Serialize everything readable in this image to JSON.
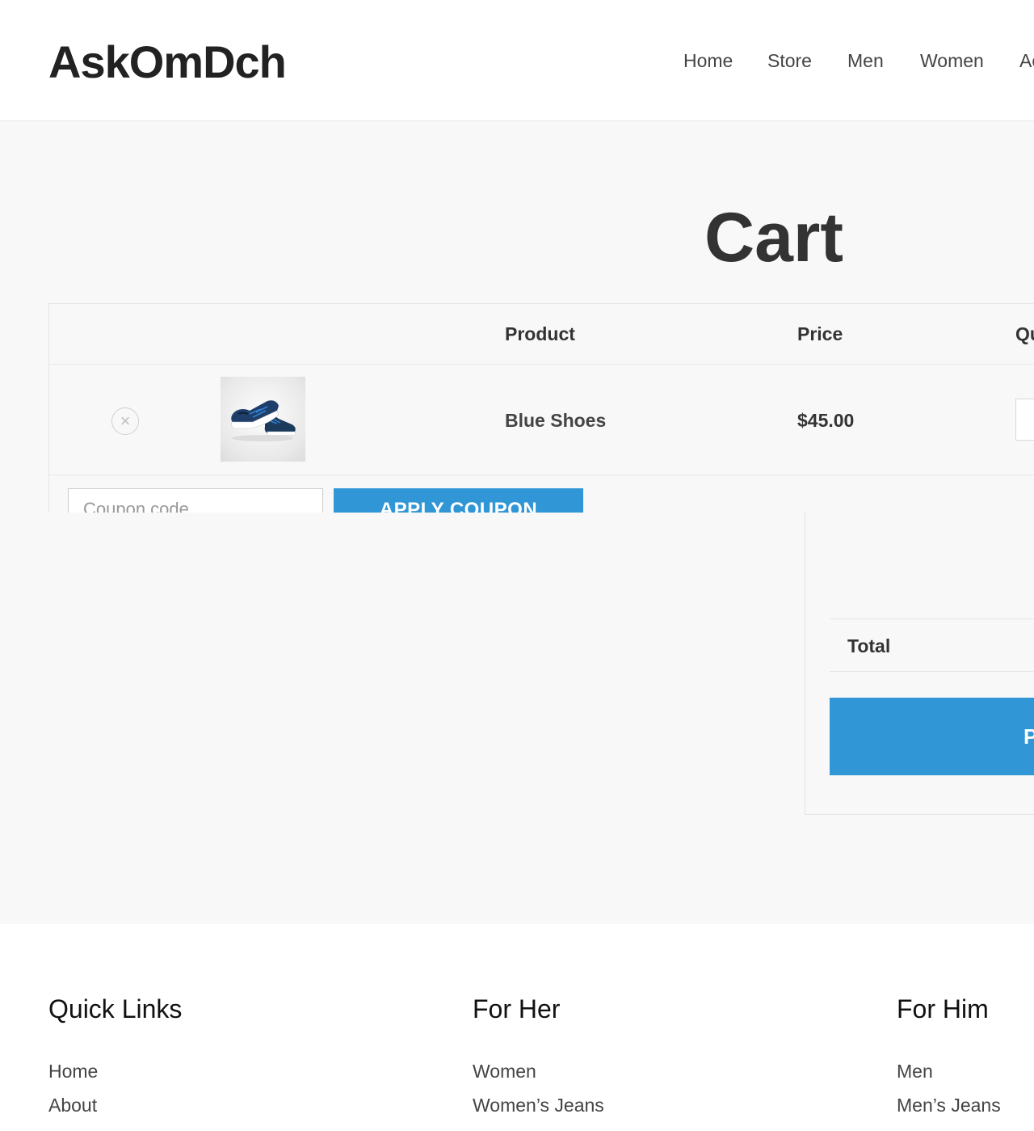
{
  "header": {
    "site_title": "AskOmDch",
    "nav": [
      "Home",
      "Store",
      "Men",
      "Women",
      "Ac"
    ]
  },
  "page": {
    "title": "Cart"
  },
  "cart": {
    "columns": {
      "product": "Product",
      "price": "Price",
      "quantity": "Qu"
    },
    "items": [
      {
        "remove_icon": "×",
        "image_icon": "blue-shoes-image",
        "name": "Blue Shoes",
        "price": "$45.00"
      }
    ],
    "coupon": {
      "placeholder": "Coupon code",
      "apply_label": "APPLY COUPON"
    }
  },
  "totals": {
    "total_label": "Total",
    "checkout_label": "P"
  },
  "footer": {
    "columns": [
      {
        "heading": "Quick Links",
        "links": [
          "Home",
          "About"
        ]
      },
      {
        "heading": "For Her",
        "links": [
          "Women",
          "Women’s Jeans"
        ]
      },
      {
        "heading": "For Him",
        "links": [
          "Men",
          "Men’s Jeans"
        ]
      }
    ]
  },
  "colors": {
    "accent": "#3196d6",
    "background": "#f8f8f8",
    "border": "#e6e6e6"
  }
}
